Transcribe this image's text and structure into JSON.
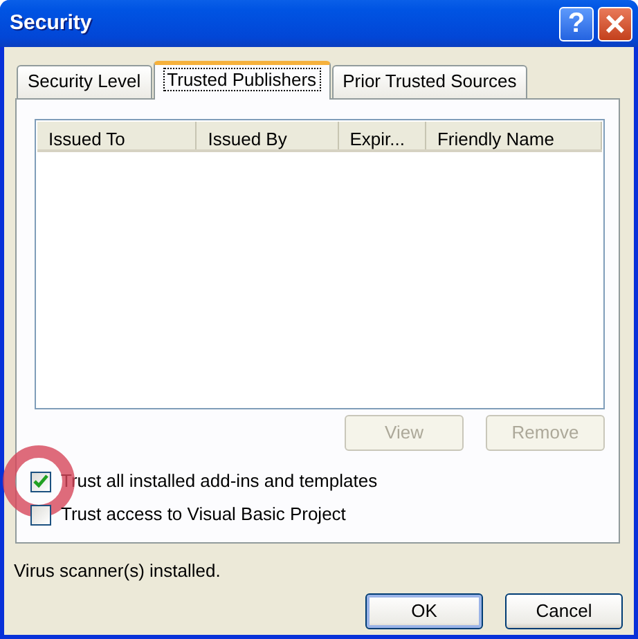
{
  "window": {
    "title": "Security",
    "title_buttons": [
      {
        "kind": "help",
        "label": "?"
      },
      {
        "kind": "close",
        "label": "×"
      }
    ]
  },
  "tabs": [
    {
      "label": "Security Level",
      "selected": false
    },
    {
      "label": "Trusted Publishers",
      "selected": true
    },
    {
      "label": "Prior Trusted Sources",
      "selected": false
    }
  ],
  "table": {
    "columns": [
      "Issued To",
      "Issued By",
      "Expir...",
      "Friendly Name"
    ]
  },
  "list_buttons": [
    {
      "label": "View",
      "disabled": true
    },
    {
      "label": "Remove",
      "disabled": true
    }
  ],
  "options": [
    {
      "label": "Trust all installed add-ins and templates",
      "checked": true,
      "highlighted": true
    },
    {
      "label": "Trust access to Visual Basic Project",
      "checked": false,
      "highlighted": false
    }
  ],
  "status_text": "Virus scanner(s) installed.",
  "buttons": [
    {
      "label": "OK",
      "default": true
    },
    {
      "label": "Cancel",
      "default": false
    }
  ]
}
